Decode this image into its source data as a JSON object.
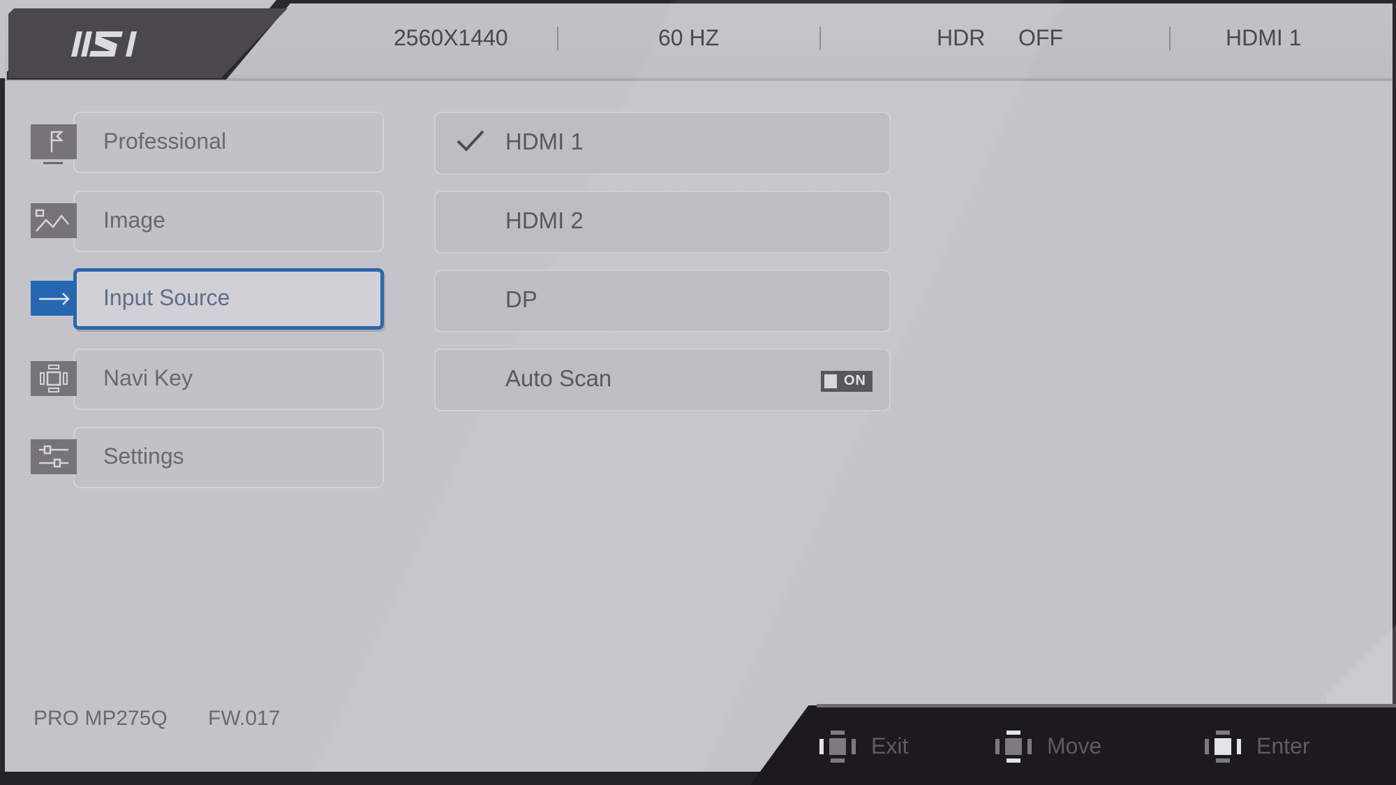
{
  "brand": {
    "logo_text": "MSI"
  },
  "status_bar": {
    "resolution": "2560X1440",
    "refresh_rate": "60 HZ",
    "hdr_label": "HDR",
    "hdr_value": "OFF",
    "input": "HDMI 1"
  },
  "menu": {
    "items": [
      {
        "label": "Professional",
        "icon": "flag-icon",
        "active": false
      },
      {
        "label": "Image",
        "icon": "image-icon",
        "active": false
      },
      {
        "label": "Input Source",
        "icon": "arrow-right-icon",
        "active": true
      },
      {
        "label": "Navi Key",
        "icon": "navi-key-icon",
        "active": false
      },
      {
        "label": "Settings",
        "icon": "sliders-icon",
        "active": false
      }
    ]
  },
  "input_source": {
    "options": [
      {
        "label": "HDMI 1",
        "selected": true
      },
      {
        "label": "HDMI 2",
        "selected": false
      },
      {
        "label": "DP",
        "selected": false
      }
    ],
    "auto_scan": {
      "label": "Auto Scan",
      "value": "ON"
    }
  },
  "footer": {
    "model": "PRO MP275Q",
    "firmware": "FW.017"
  },
  "nav_hints": [
    {
      "label": "Exit",
      "icon": "joystick-left-icon"
    },
    {
      "label": "Move",
      "icon": "joystick-updown-icon"
    },
    {
      "label": "Enter",
      "icon": "joystick-press-icon"
    }
  ],
  "colors": {
    "accent": "#2c67ab",
    "background": "#c4c3ca",
    "dark": "#1c1a1e"
  }
}
